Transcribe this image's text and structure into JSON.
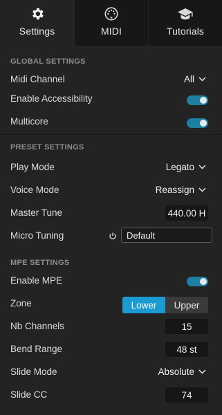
{
  "tabs": [
    {
      "label": "Settings",
      "icon": "gear-icon",
      "active": true
    },
    {
      "label": "MIDI",
      "icon": "midi-din-icon",
      "active": false
    },
    {
      "label": "Tutorials",
      "icon": "graduation-cap-icon",
      "active": false
    }
  ],
  "colors": {
    "accent": "#1a9bd2",
    "toggle_on": "#1f7fa3",
    "background": "#232323",
    "section_header": "#8e8e8e"
  },
  "global": {
    "header": "GLOBAL SETTINGS",
    "midi_channel": {
      "label": "Midi Channel",
      "value": "All"
    },
    "accessibility": {
      "label": "Enable Accessibility",
      "on": true
    },
    "multicore": {
      "label": "Multicore",
      "on": true
    }
  },
  "preset": {
    "header": "PRESET SETTINGS",
    "play_mode": {
      "label": "Play Mode",
      "value": "Legato"
    },
    "voice_mode": {
      "label": "Voice Mode",
      "value": "Reassign"
    },
    "master_tune": {
      "label": "Master Tune",
      "value": "440.00 H"
    },
    "micro_tuning": {
      "label": "Micro Tuning",
      "value": "Default",
      "icon": "power-icon"
    }
  },
  "mpe": {
    "header": "MPE SETTINGS",
    "enable": {
      "label": "Enable MPE",
      "on": true
    },
    "zone": {
      "label": "Zone",
      "options": [
        "Lower",
        "Upper"
      ],
      "selected": "Lower"
    },
    "nb_channels": {
      "label": "Nb Channels",
      "value": "15"
    },
    "bend_range": {
      "label": "Bend Range",
      "value": "48 st"
    },
    "slide_mode": {
      "label": "Slide Mode",
      "value": "Absolute"
    },
    "slide_cc": {
      "label": "Slide CC",
      "value": "74"
    }
  }
}
